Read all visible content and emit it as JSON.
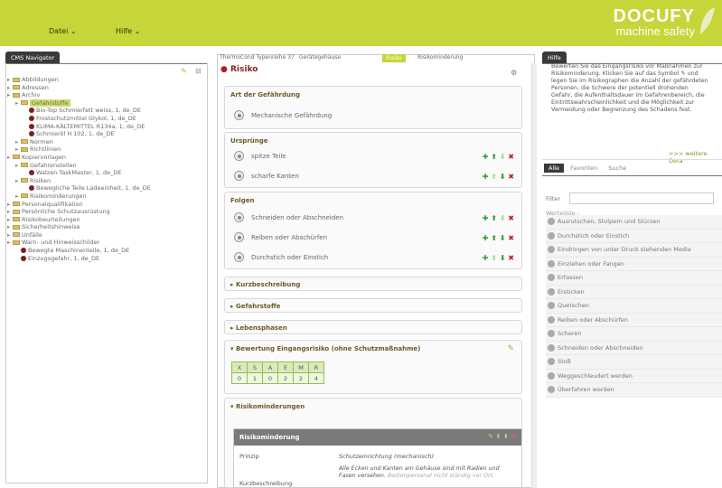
{
  "menu": {
    "file": "Datei",
    "help": "Hilfe"
  },
  "logo": {
    "brand": "DOCUFY",
    "tagline": "machine safety"
  },
  "navigator": {
    "title": "CMS Navigator"
  },
  "tree": [
    {
      "label": "Abbildungen",
      "type": "folder",
      "indent": 0
    },
    {
      "label": "Adressen",
      "type": "folder",
      "indent": 0
    },
    {
      "label": "Archiv",
      "type": "folder",
      "indent": 0
    },
    {
      "label": "Gefahrstoffe",
      "type": "folder",
      "indent": 1,
      "selected": true
    },
    {
      "label": "Bio-Top Schmierfett weiss, 1, de_DE",
      "type": "page",
      "indent": 2
    },
    {
      "label": "Frostschutzmittel Glykol, 1, de_DE",
      "type": "page",
      "indent": 2
    },
    {
      "label": "KLIMA-KÄLTEMITTEL R134a, 1, de_DE",
      "type": "page",
      "indent": 2
    },
    {
      "label": "Schmieröl H 102, 1, de_DE",
      "type": "page",
      "indent": 2
    },
    {
      "label": "Normen",
      "type": "folder",
      "indent": 1
    },
    {
      "label": "Richtlinien",
      "type": "folder",
      "indent": 1
    },
    {
      "label": "Kopiervorlagen",
      "type": "folder",
      "indent": 0
    },
    {
      "label": "Gefahrenstellen",
      "type": "folder",
      "indent": 1
    },
    {
      "label": "Walzen TaskMaster, 1, de_DE",
      "type": "page",
      "indent": 2
    },
    {
      "label": "Risiken",
      "type": "folder",
      "indent": 1
    },
    {
      "label": "Bewegliche Teile Ladeeinheit, 1, de_DE",
      "type": "page",
      "indent": 2
    },
    {
      "label": "Risikominderungen",
      "type": "folder",
      "indent": 1
    },
    {
      "label": "Personalqualifikation",
      "type": "folder",
      "indent": 0
    },
    {
      "label": "Persönliche Schutzausrüstung",
      "type": "folder",
      "indent": 0
    },
    {
      "label": "Risikobeurteilungen",
      "type": "folder",
      "indent": 0
    },
    {
      "label": "Sicherheitshinweise",
      "type": "folder",
      "indent": 0
    },
    {
      "label": "Unfälle",
      "type": "folder",
      "indent": 0
    },
    {
      "label": "Warn- und Hinweisschilder",
      "type": "folder",
      "indent": 0
    },
    {
      "label": "Bewegte Maschinenteile, 1, de_DE",
      "type": "page",
      "indent": 1
    },
    {
      "label": "Einzugsgefahr, 1, de_DE",
      "type": "page",
      "indent": 1
    }
  ],
  "breadcrumb": {
    "t1": "ThermoCond Typenreihe 37",
    "t2": "Gerätegehäuse",
    "t3": "Risiko",
    "t4": "Risikominderung"
  },
  "risk_title": "Risiko",
  "hazard": {
    "header": "Art der Gefährdung",
    "item": "Mechanische Gefährdung"
  },
  "origins": {
    "header": "Ursprünge",
    "items": [
      "spitze Teile",
      "scharfe Kanten"
    ]
  },
  "consequences": {
    "header": "Folgen",
    "items": [
      "Schneiden oder Abschneiden",
      "Reiben oder Abschürfen",
      "Durchstich oder Einstich"
    ]
  },
  "collapsed": [
    "Kurzbeschreibung",
    "Gefahrstoffe",
    "Lebensphasen"
  ],
  "assessment": {
    "header": "Bewertung Eingangsrisiko (ohne Schutzmaßnahme)",
    "keys": [
      "X",
      "S",
      "A",
      "E",
      "M",
      "R"
    ],
    "values": [
      "0",
      "1",
      "0",
      "2",
      "2",
      "4"
    ]
  },
  "mitigations": {
    "header": "Risikominderungen",
    "card_title": "Risikominderung",
    "principle_label": "Prinzip",
    "principle_value": "Schutzeinrichtung (mechanisch)",
    "desc_label": "Kurzbeschreibung",
    "desc_value": "Alle Ecken und Kanten am Gehäuse sind mit Radien und Fasen versehen.",
    "desc_value2": "Bedienpersonal nicht ständig vor Ort."
  },
  "help": {
    "title": "Hilfe",
    "text": "Bewerten Sie das Eingangsrisiko vor Maßnahmen zur Risikominderung. Klicken Sie auf das Symbol ✎ und legen Sie im Risikographen die Anzahl der gefährdeten Personen, die Schwere der potentiell drohenden Gefahr, die Aufenthaltsdauer im Gefahrenbereich, die Eintrittswahrscheinlichkeit und die Möglichkeit zur Vermeidung oder Begrenzung des Schadens fest.",
    "more": ">>> weitere Deta"
  },
  "filter_tabs": [
    "Alle",
    "Favoriten",
    "Suche"
  ],
  "filter_label": "Filter",
  "value_list_title": "Werteliste -",
  "value_list": [
    "Ausrutschen, Stolpern und Stürzen",
    "Durchstich oder Einstich",
    "Eindringen von unter Druck stehenden Medie",
    "Einziehen oder Fangen",
    "Erfassen",
    "Ersticken",
    "Quetschen",
    "Reiben oder Abschürfen",
    "Scheren",
    "Schneiden oder Abschneiden",
    "Stoß",
    "Weggeschleudert werden",
    "Überfahren werden"
  ]
}
